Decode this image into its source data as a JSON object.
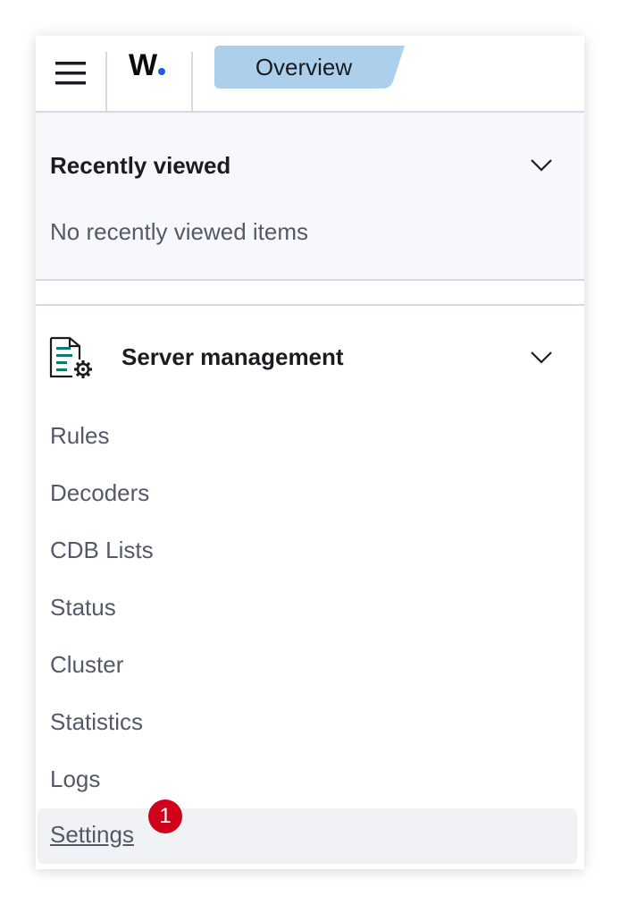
{
  "header": {
    "logo_text": "W",
    "breadcrumb": "Overview",
    "breadcrumb_color": "#acd0eb"
  },
  "recently_viewed": {
    "title": "Recently viewed",
    "empty_text": "No recently viewed items"
  },
  "server_management": {
    "title": "Server management",
    "items": [
      {
        "label": "Rules"
      },
      {
        "label": "Decoders"
      },
      {
        "label": "CDB Lists"
      },
      {
        "label": "Status"
      },
      {
        "label": "Cluster"
      },
      {
        "label": "Statistics"
      },
      {
        "label": "Logs"
      },
      {
        "label": "Settings"
      }
    ]
  },
  "annotation": {
    "badge": "1",
    "badge_color": "#d0021b"
  },
  "icons": [
    "hamburger-menu-icon",
    "logo-dot",
    "chevron-down-icon",
    "server-settings-icon"
  ]
}
